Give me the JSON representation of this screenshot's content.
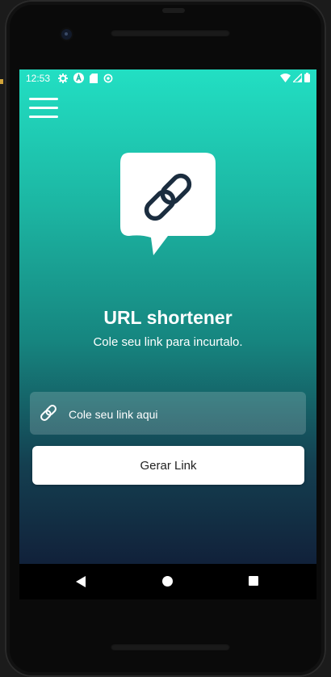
{
  "status_bar": {
    "time": "12:53",
    "left_icons": [
      "settings-icon",
      "a-circle-icon",
      "sd-card-icon",
      "sync-icon"
    ],
    "right_icons": [
      "wifi-icon",
      "signal-icon",
      "battery-icon"
    ]
  },
  "menu": {
    "icon": "hamburger-icon"
  },
  "hero": {
    "icon": "chain-link-speech-bubble-icon",
    "title": "URL shortener",
    "subtitle": "Cole seu link para incurtalo."
  },
  "input": {
    "icon": "link-icon",
    "placeholder": "Cole seu link aqui",
    "value": ""
  },
  "button": {
    "label": "Gerar Link"
  },
  "nav_bar": {
    "back": "back-icon",
    "home": "home-icon",
    "recents": "recents-icon"
  },
  "colors": {
    "gradient_top": "#22dfc3",
    "gradient_bottom": "#11213a",
    "icon_ink": "#1b2d3f",
    "button_bg": "#ffffff"
  }
}
